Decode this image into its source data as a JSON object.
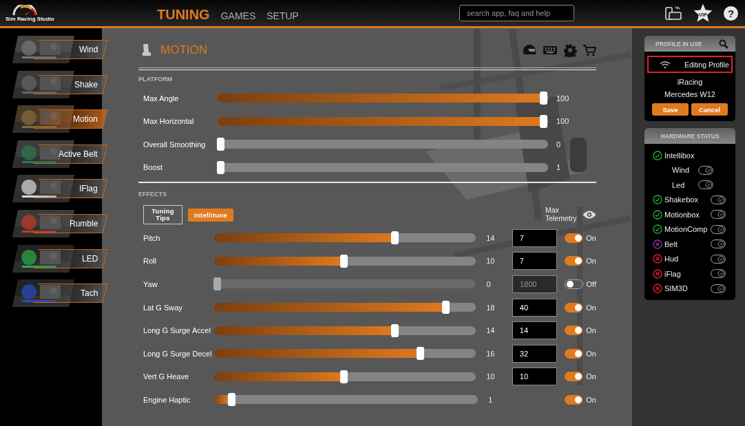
{
  "header": {
    "logo_text": "Sim Racing Studio",
    "nav": [
      {
        "label": "TUNING",
        "selected": true
      },
      {
        "label": "GAMES",
        "selected": false
      },
      {
        "label": "SETUP",
        "selected": false
      }
    ],
    "search": {
      "placeholder": "search app, faq and help"
    },
    "vip_badge": "VIP",
    "help": "?"
  },
  "sidebar": {
    "items": [
      {
        "label": "Wind",
        "selected": false
      },
      {
        "label": "Shake",
        "selected": false
      },
      {
        "label": "Motion",
        "selected": true
      },
      {
        "label": "Active Belt",
        "selected": false
      },
      {
        "label": "IFlag",
        "selected": false
      },
      {
        "label": "Rumble",
        "selected": false
      },
      {
        "label": "LED",
        "selected": false
      },
      {
        "label": "Tach",
        "selected": false
      }
    ]
  },
  "section": {
    "title": "MOTION"
  },
  "platform": {
    "heading": "PLATFORM",
    "sliders": [
      {
        "label": "Max Angle",
        "level": 1,
        "reading": "100"
      },
      {
        "label": "Max Horizontal",
        "level": 1,
        "reading": "100"
      },
      {
        "label": "Overall Smoothing",
        "level": 0,
        "reading": "0"
      },
      {
        "label": "Boost",
        "level": 0,
        "reading": "1"
      }
    ]
  },
  "effects": {
    "heading": "EFFECTS",
    "buttons": [
      {
        "label": "Tuning Tips",
        "kind": "outline"
      },
      {
        "label": "Intellitune",
        "kind": "filled"
      }
    ],
    "max_telemetry": "Max Telemetry",
    "rows": [
      {
        "label": "Pitch",
        "level": 0.7,
        "reading": "14",
        "value": "7",
        "on": true,
        "toggle_label": "On"
      },
      {
        "label": "Roll",
        "level": 0.5,
        "reading": "10",
        "value": "7",
        "on": true,
        "toggle_label": "On"
      },
      {
        "label": "Yaw",
        "level": 0,
        "reading": "0",
        "value": "1800",
        "on": false,
        "toggle_label": "Off"
      },
      {
        "label": "Lat G Sway",
        "level": 0.9,
        "reading": "18",
        "value": "40",
        "on": true,
        "toggle_label": "On"
      },
      {
        "label": "Long G Surge Accel",
        "level": 0.7,
        "reading": "14",
        "value": "14",
        "on": true,
        "toggle_label": "On"
      },
      {
        "label": "Long G Surge Decel",
        "level": 0.8,
        "reading": "16",
        "value": "32",
        "on": true,
        "toggle_label": "On"
      },
      {
        "label": "Vert G Heave",
        "level": 0.5,
        "reading": "10",
        "value": "10",
        "on": true,
        "toggle_label": "On"
      },
      {
        "label": "Engine Haptic",
        "level": 0.055,
        "reading": "1",
        "on": true,
        "toggle_label": "On"
      }
    ]
  },
  "profile": {
    "heading": "PROFILE IN USE",
    "status": "Editing Profile",
    "highlighted": true,
    "game": "iRacing",
    "car": "Mercedes W12",
    "buttons": [
      "Save",
      "Cancel"
    ]
  },
  "hardware": {
    "heading": "HARDWARE STATUS",
    "items": [
      {
        "name": "Intellibox",
        "kind": "check",
        "color": "#2fae2f",
        "children": [
          {
            "name": "Wind",
            "on": true
          },
          {
            "name": "Led",
            "on": true
          }
        ]
      },
      {
        "name": "Shakebox",
        "kind": "check",
        "color": "#2fae2f",
        "on": true
      },
      {
        "name": "Motionbox",
        "kind": "check",
        "color": "#2fae2f",
        "on": true
      },
      {
        "name": "MotionComp",
        "kind": "check",
        "color": "#2fae2f",
        "on": true
      },
      {
        "name": "Belt",
        "kind": "cross",
        "color": "#9b2fae",
        "on": true
      },
      {
        "name": "Hud",
        "kind": "cross",
        "color": "#e8212b",
        "on": true
      },
      {
        "name": "iFlag",
        "kind": "cross",
        "color": "#e8212b",
        "on": true
      },
      {
        "name": "SIM3D",
        "kind": "cross",
        "color": "#e8212b",
        "on": true
      }
    ]
  }
}
